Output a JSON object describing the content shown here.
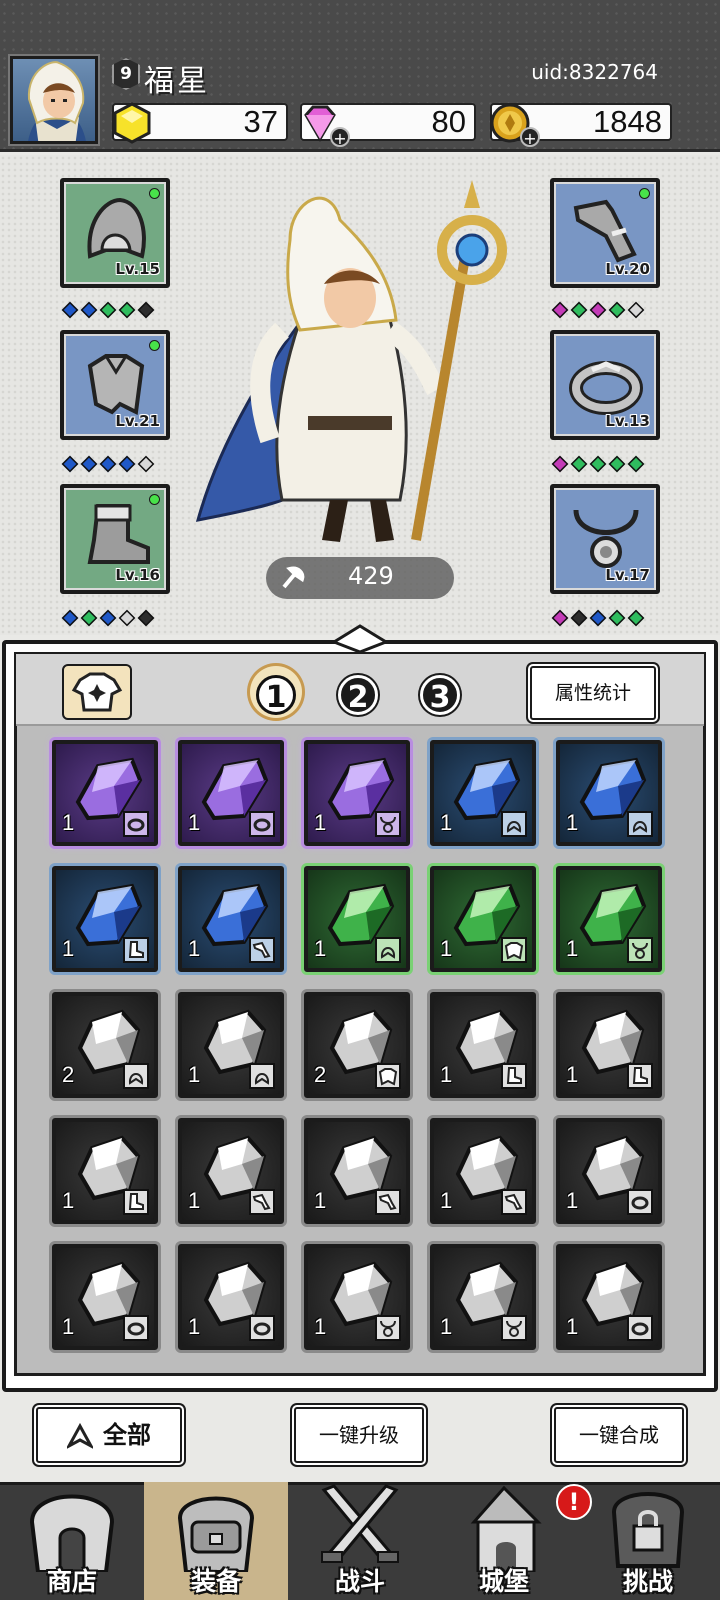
{
  "player": {
    "level": "9",
    "name": "福星",
    "uid": "uid:8322764"
  },
  "resources": {
    "energy": {
      "value": "37",
      "icon": "yellow-gem-icon"
    },
    "diamonds": {
      "value": "80",
      "icon": "pink-diamond-icon"
    },
    "coins": {
      "value": "1848",
      "icon": "gold-coin-icon"
    }
  },
  "equipment": {
    "left": [
      {
        "slot": "hood",
        "level": "Lv.15",
        "quality": "green",
        "gems": [
          "#1f58c8",
          "#1f58c8",
          "#2fbd5e",
          "#2fbd5e",
          "#2d2d2d"
        ]
      },
      {
        "slot": "armor",
        "level": "Lv.21",
        "quality": "blue",
        "gems": [
          "#1f58c8",
          "#1f58c8",
          "#1f58c8",
          "#1f58c8",
          "#d8d8d8"
        ]
      },
      {
        "slot": "boots",
        "level": "Lv.16",
        "quality": "green",
        "gems": [
          "#1f58c8",
          "#2fbd5e",
          "#1f58c8",
          "#d8d8d8",
          "#2d2d2d"
        ]
      }
    ],
    "right": [
      {
        "slot": "gauntlet",
        "level": "Lv.20",
        "quality": "blue",
        "gems": [
          "#c43bb8",
          "#2fbd5e",
          "#c43bb8",
          "#2fbd5e",
          "#d8d8d8"
        ]
      },
      {
        "slot": "ring",
        "level": "Lv.13",
        "quality": "blue",
        "gems": [
          "#c43bb8",
          "#2fbd5e",
          "#2fbd5e",
          "#2fbd5e",
          "#2fbd5e"
        ]
      },
      {
        "slot": "necklace",
        "level": "Lv.17",
        "quality": "blue",
        "gems": [
          "#c43bb8",
          "#2d2d2d",
          "#1f58c8",
          "#2fbd5e",
          "#2fbd5e"
        ]
      }
    ]
  },
  "power": "429",
  "inventory": {
    "pages": [
      "1",
      "2",
      "3"
    ],
    "active_page": "1",
    "attr_button": "属性统计",
    "items": [
      {
        "quality": "purple",
        "count": "1",
        "type": "ring"
      },
      {
        "quality": "purple",
        "count": "1",
        "type": "ring"
      },
      {
        "quality": "purple",
        "count": "1",
        "type": "necklace"
      },
      {
        "quality": "blue",
        "count": "1",
        "type": "hood"
      },
      {
        "quality": "blue",
        "count": "1",
        "type": "hood"
      },
      {
        "quality": "blue",
        "count": "1",
        "type": "boots"
      },
      {
        "quality": "blue",
        "count": "1",
        "type": "gauntlet"
      },
      {
        "quality": "green",
        "count": "1",
        "type": "hood"
      },
      {
        "quality": "green",
        "count": "1",
        "type": "armor"
      },
      {
        "quality": "green",
        "count": "1",
        "type": "necklace"
      },
      {
        "quality": "gray",
        "count": "2",
        "type": "hood"
      },
      {
        "quality": "gray",
        "count": "1",
        "type": "hood"
      },
      {
        "quality": "gray",
        "count": "2",
        "type": "armor"
      },
      {
        "quality": "gray",
        "count": "1",
        "type": "boots"
      },
      {
        "quality": "gray",
        "count": "1",
        "type": "boots"
      },
      {
        "quality": "gray",
        "count": "1",
        "type": "boots"
      },
      {
        "quality": "gray",
        "count": "1",
        "type": "gauntlet"
      },
      {
        "quality": "gray",
        "count": "1",
        "type": "gauntlet"
      },
      {
        "quality": "gray",
        "count": "1",
        "type": "gauntlet"
      },
      {
        "quality": "gray",
        "count": "1",
        "type": "ring"
      },
      {
        "quality": "gray",
        "count": "1",
        "type": "ring"
      },
      {
        "quality": "gray",
        "count": "1",
        "type": "ring"
      },
      {
        "quality": "gray",
        "count": "1",
        "type": "necklace"
      },
      {
        "quality": "gray",
        "count": "1",
        "type": "necklace"
      },
      {
        "quality": "gray",
        "count": "1",
        "type": "ring"
      }
    ]
  },
  "actions": {
    "filter": "全部",
    "upgrade_all": "一键升级",
    "synthesize_all": "一键合成"
  },
  "nav": {
    "items": [
      "商店",
      "装备",
      "战斗",
      "城堡",
      "挑战"
    ],
    "active": "装备",
    "alert": "!"
  }
}
